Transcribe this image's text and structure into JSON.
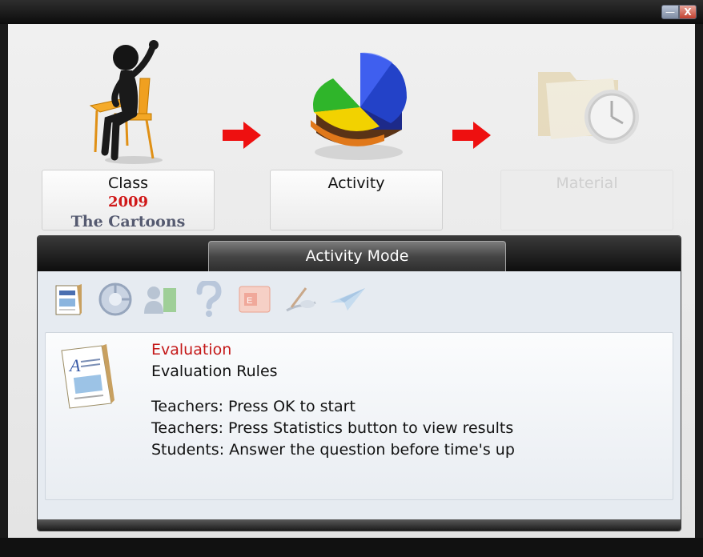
{
  "window": {
    "minimize_label": "—",
    "close_label": "X"
  },
  "steps": [
    {
      "label": "Class",
      "year": "2009",
      "name": "The Cartoons",
      "icon": "student-at-desk-icon",
      "enabled": true
    },
    {
      "label": "Activity",
      "icon": "pie-chart-icon",
      "enabled": true
    },
    {
      "label": "Material",
      "icon": "folder-clock-icon",
      "enabled": false
    }
  ],
  "panel": {
    "title": "Activity Mode",
    "toolbar": [
      "evaluation-calendar-icon",
      "statistics-chart-icon",
      "user-book-icon",
      "question-icon",
      "presentation-icon",
      "pen-hand-icon",
      "paper-plane-icon"
    ],
    "content": {
      "title": "Evaluation",
      "subtitle": "Evaluation Rules",
      "lines": [
        "Teachers: Press OK to start",
        "Teachers: Press Statistics button to view results",
        "Students: Answer the question before time's up"
      ]
    }
  },
  "colors": {
    "accent_red": "#d01818",
    "class_name": "#555a70",
    "panel_bg": "#e6ebf1"
  }
}
